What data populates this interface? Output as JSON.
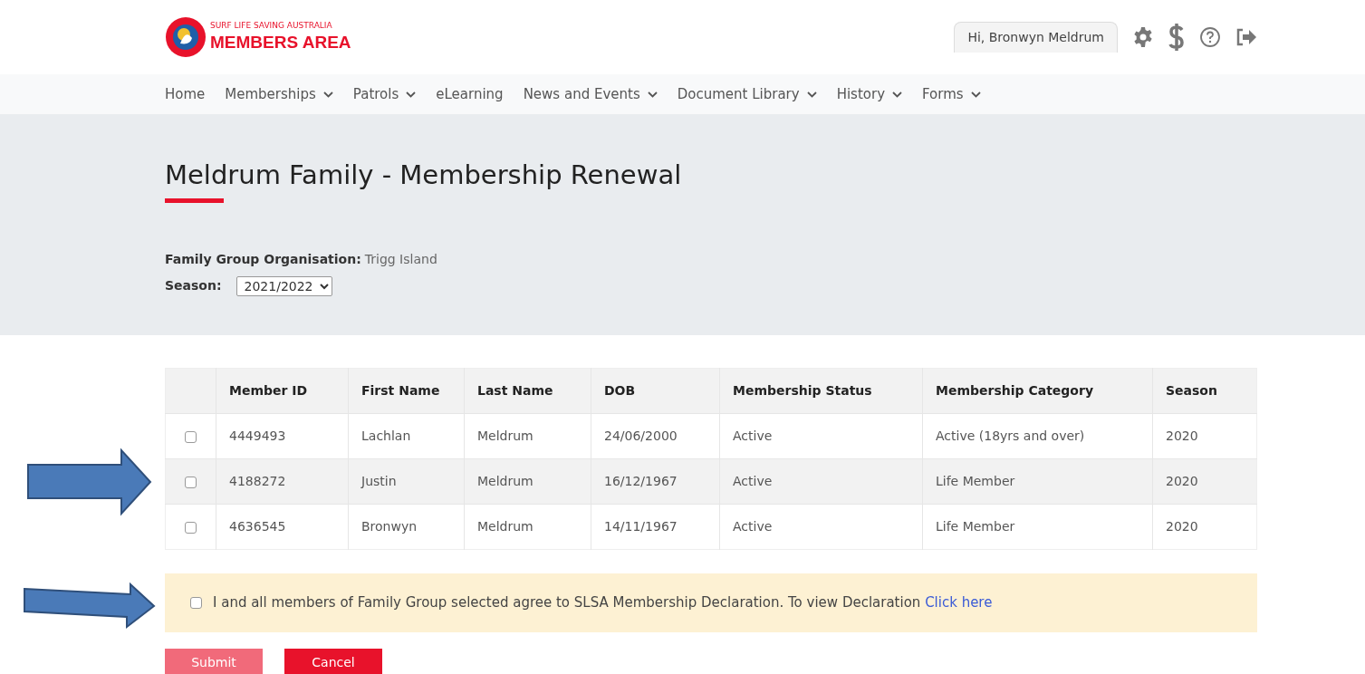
{
  "header": {
    "logo_tagline": "SURF LIFE SAVING AUSTRALIA",
    "logo_title": "MEMBERS AREA",
    "greeting": "Hi, Bronwyn Meldrum"
  },
  "nav": [
    {
      "label": "Home",
      "dropdown": false
    },
    {
      "label": "Memberships",
      "dropdown": true
    },
    {
      "label": "Patrols",
      "dropdown": true
    },
    {
      "label": "eLearning",
      "dropdown": false
    },
    {
      "label": "News and Events",
      "dropdown": true
    },
    {
      "label": "Document Library",
      "dropdown": true
    },
    {
      "label": "History",
      "dropdown": true
    },
    {
      "label": "Forms",
      "dropdown": true
    }
  ],
  "page_title": "Meldrum Family - Membership Renewal",
  "family_group": {
    "label": "Family Group Organisation:",
    "value": "Trigg Island"
  },
  "season": {
    "label": "Season:",
    "value": "2021/2022"
  },
  "table": {
    "columns": [
      "Member ID",
      "First Name",
      "Last Name",
      "DOB",
      "Membership Status",
      "Membership Category",
      "Season"
    ],
    "rows": [
      {
        "checked": false,
        "cells": [
          "4449493",
          "Lachlan",
          "Meldrum",
          "24/06/2000",
          "Active",
          "Active (18yrs and over)",
          "2020"
        ]
      },
      {
        "checked": false,
        "cells": [
          "4188272",
          "Justin",
          "Meldrum",
          "16/12/1967",
          "Active",
          "Life Member",
          "2020"
        ]
      },
      {
        "checked": false,
        "cells": [
          "4636545",
          "Bronwyn",
          "Meldrum",
          "14/11/1967",
          "Active",
          "Life Member",
          "2020"
        ]
      }
    ]
  },
  "declaration": {
    "checked": false,
    "text": "I and all members of Family Group selected agree to SLSA Membership Declaration. To view Declaration",
    "link": "Click here"
  },
  "buttons": [
    {
      "label": "Submit",
      "disabled": true
    },
    {
      "label": "Cancel",
      "disabled": false
    }
  ]
}
